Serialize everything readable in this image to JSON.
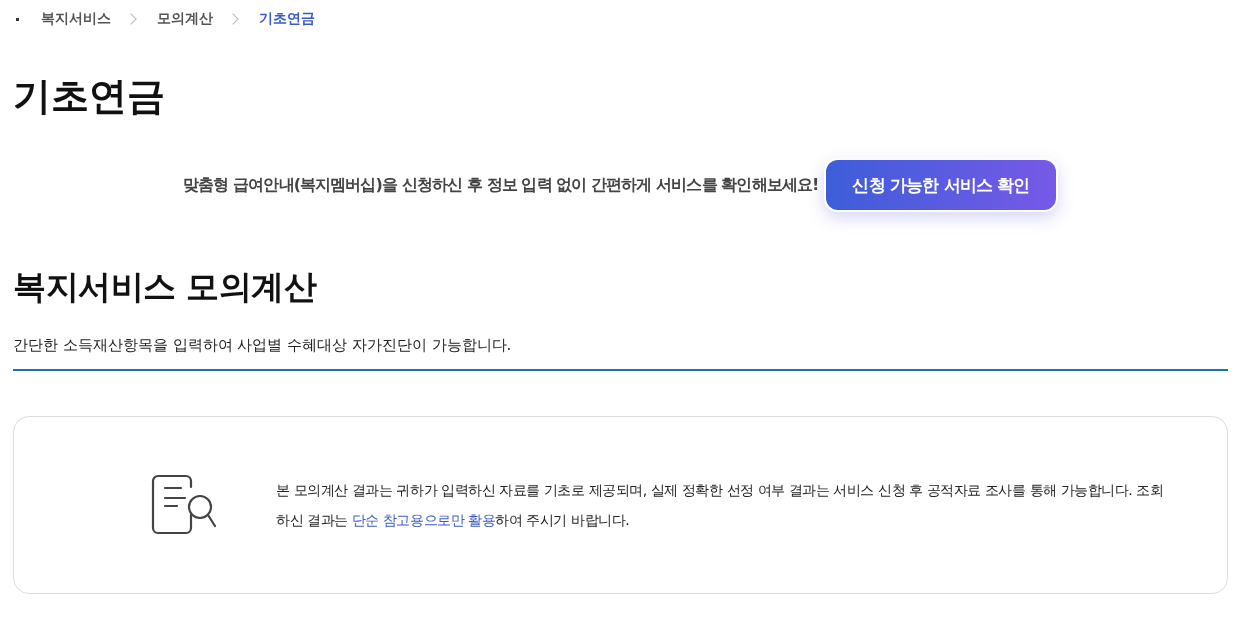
{
  "breadcrumb": [
    {
      "label": "복지서비스",
      "current": false
    },
    {
      "label": "모의계산",
      "current": false
    },
    {
      "label": "기초연금",
      "current": true
    }
  ],
  "page_title": "기초연금",
  "banner": {
    "message": "맞춤형 급여안내(복지멤버십)을 신청하신 후 정보 입력 없이 간편하게 서비스를 확인해보세요!",
    "button": "신청 가능한 서비스 확인"
  },
  "section": {
    "title": "복지서비스 모의계산",
    "description": "간단한 소득재산항목을 입력하여 사업별 수혜대상 자가진단이 가능합니다."
  },
  "notice": {
    "parts": [
      {
        "text": "본 모의계산 결과는 귀하가 입력하신 자료를 기초로 제공되며, 실제 정확한 선정 여부 결과는 서비스 신청 후 공적자료 조사를 통해 가능합니다. 조회하신 결과는 ",
        "highlight": false
      },
      {
        "text": "단순 참고용으로만 활용",
        "highlight": true
      },
      {
        "text": "하여 주시기 바랍니다.",
        "highlight": false
      }
    ]
  }
}
